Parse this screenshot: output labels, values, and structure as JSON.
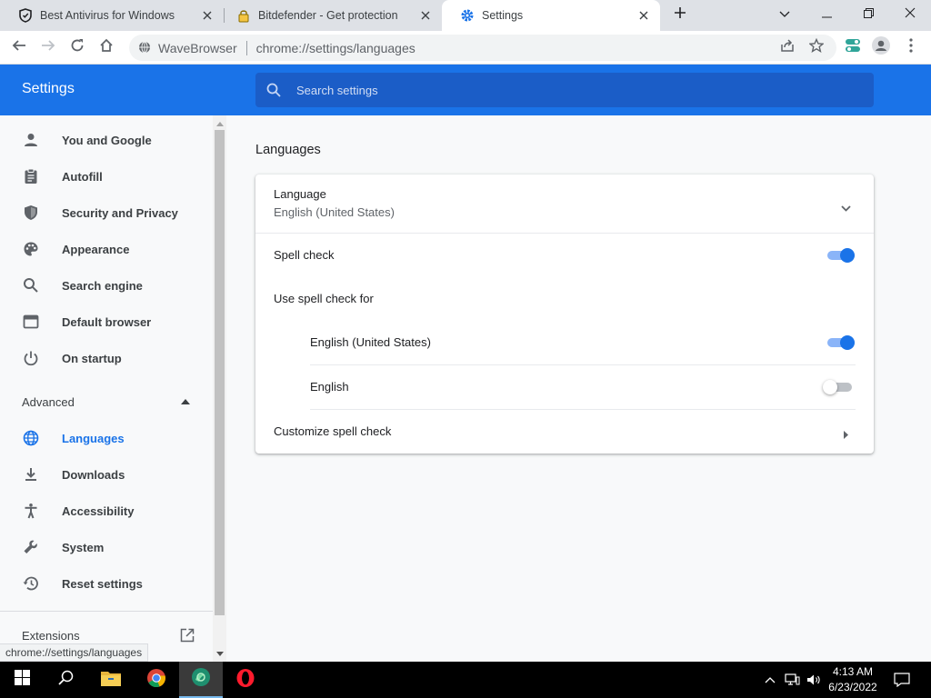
{
  "tabs": [
    {
      "title": "Best Antivirus for Windows",
      "icon": "shield-favicon"
    },
    {
      "title": "Bitdefender - Get protection",
      "icon": "lock-favicon"
    },
    {
      "title": "Settings",
      "icon": "gear-favicon",
      "active": true
    }
  ],
  "new_tab_icon": "plus-icon",
  "window_controls": [
    "tab-search-icon",
    "minimize-icon",
    "restore-icon",
    "close-icon"
  ],
  "toolbar": {
    "brand": "WaveBrowser",
    "url": "chrome://settings/languages"
  },
  "header": {
    "title": "Settings",
    "search_placeholder": "Search settings"
  },
  "sidebar": {
    "items": [
      {
        "label": "You and Google",
        "icon": "person-icon"
      },
      {
        "label": "Autofill",
        "icon": "clipboard-icon"
      },
      {
        "label": "Security and Privacy",
        "icon": "shield-icon"
      },
      {
        "label": "Appearance",
        "icon": "palette-icon"
      },
      {
        "label": "Search engine",
        "icon": "search-icon"
      },
      {
        "label": "Default browser",
        "icon": "browser-icon"
      },
      {
        "label": "On startup",
        "icon": "power-icon"
      }
    ],
    "advanced_label": "Advanced",
    "advanced_items": [
      {
        "label": "Languages",
        "icon": "globe-icon",
        "active": true
      },
      {
        "label": "Downloads",
        "icon": "download-icon"
      },
      {
        "label": "Accessibility",
        "icon": "accessibility-icon"
      },
      {
        "label": "System",
        "icon": "wrench-icon"
      },
      {
        "label": "Reset settings",
        "icon": "history-icon"
      }
    ],
    "extensions_label": "Extensions"
  },
  "status_tooltip": "chrome://settings/languages",
  "main": {
    "section_title": "Languages",
    "language_label": "Language",
    "language_value": "English (United States)",
    "spell_check_label": "Spell check",
    "spell_check_on": true,
    "use_spell_check_for": "Use spell check for",
    "spell_languages": [
      {
        "label": "English (United States)",
        "on": true
      },
      {
        "label": "English",
        "on": false
      }
    ],
    "customize_label": "Customize spell check"
  },
  "taskbar": {
    "time": "4:13 AM",
    "date": "6/23/2022"
  },
  "colors": {
    "accent": "#1a73e8",
    "header_bg": "#1a73e8",
    "search_bg": "#1b5dc7"
  }
}
